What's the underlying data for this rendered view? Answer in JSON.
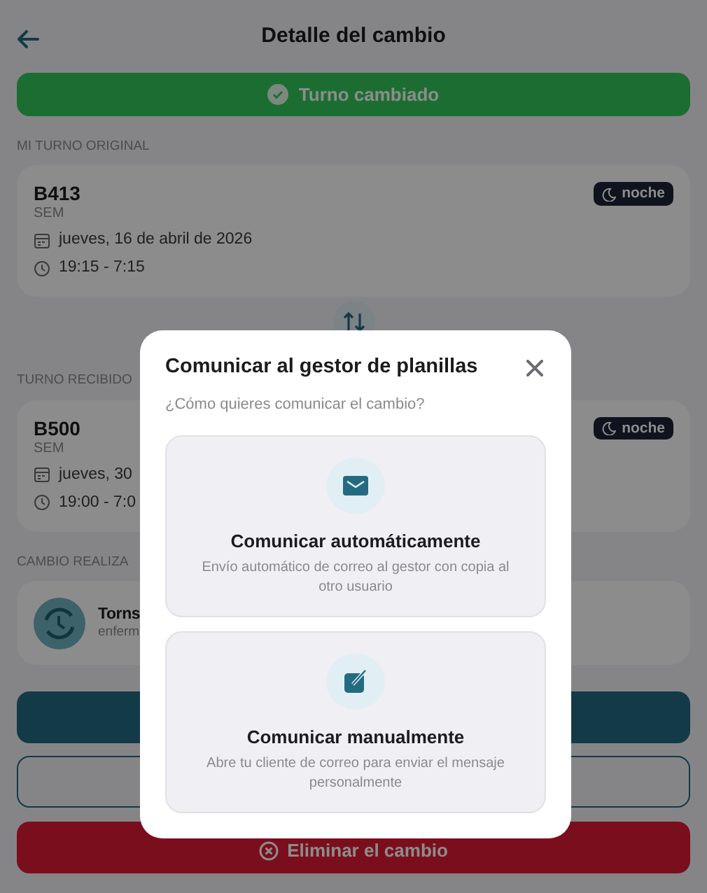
{
  "header": {
    "title": "Detalle del cambio"
  },
  "status_banner": {
    "label": "Turno cambiado"
  },
  "sections": [
    {
      "heading": "MI TURNO ORIGINAL",
      "shift": {
        "code": "B413",
        "unit": "SEM",
        "badge": "noche",
        "date": "jueves, 16 de abril de 2026",
        "time": "19:15 - 7:15"
      }
    },
    {
      "heading": "TURNO RECIBIDO",
      "shift": {
        "code": "B500",
        "unit": "SEM",
        "badge": "noche",
        "date": "jueves, 30",
        "time": "19:00 - 7:0"
      }
    }
  ],
  "change": {
    "heading": "CAMBIO REALIZA",
    "name": "Torns",
    "role": "enferm"
  },
  "actions": [
    {
      "kind": "primary"
    },
    {
      "kind": "outline"
    },
    {
      "kind": "danger",
      "label": "Eliminar el cambio"
    }
  ],
  "modal": {
    "title": "Comunicar al gestor de planillas",
    "prompt": "¿Cómo quieres comunicar el cambio?",
    "options": [
      {
        "kind": "mail",
        "title": "Comunicar automáticamente",
        "description": "Envío automático de correo al gestor con copia al otro usuario"
      },
      {
        "kind": "edit",
        "title": "Comunicar manualmente",
        "description": "Abre tu cliente de correo para enviar el mensaje personalmente"
      }
    ]
  }
}
